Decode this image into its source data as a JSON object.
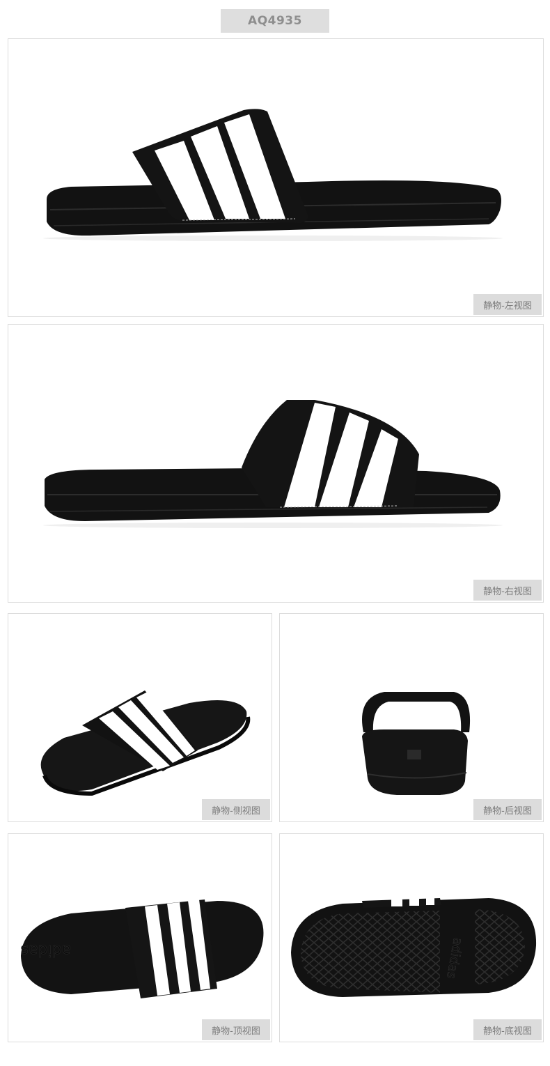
{
  "product": {
    "code": "AQ4935"
  },
  "views": [
    {
      "id": "left",
      "label": "静物-左视图"
    },
    {
      "id": "right",
      "label": "静物-右视图"
    },
    {
      "id": "side",
      "label": "静物-侧视图"
    },
    {
      "id": "back",
      "label": "静物-后视图"
    },
    {
      "id": "top",
      "label": "静物-顶视图"
    },
    {
      "id": "bottom",
      "label": "静物-底视图"
    }
  ],
  "colors": {
    "caption_bg": "#dcdcdc",
    "caption_text": "#7d7d7d",
    "sandal_black": "#111111",
    "stripe_white": "#ffffff"
  },
  "branding": {
    "logo_text": "adidas"
  }
}
